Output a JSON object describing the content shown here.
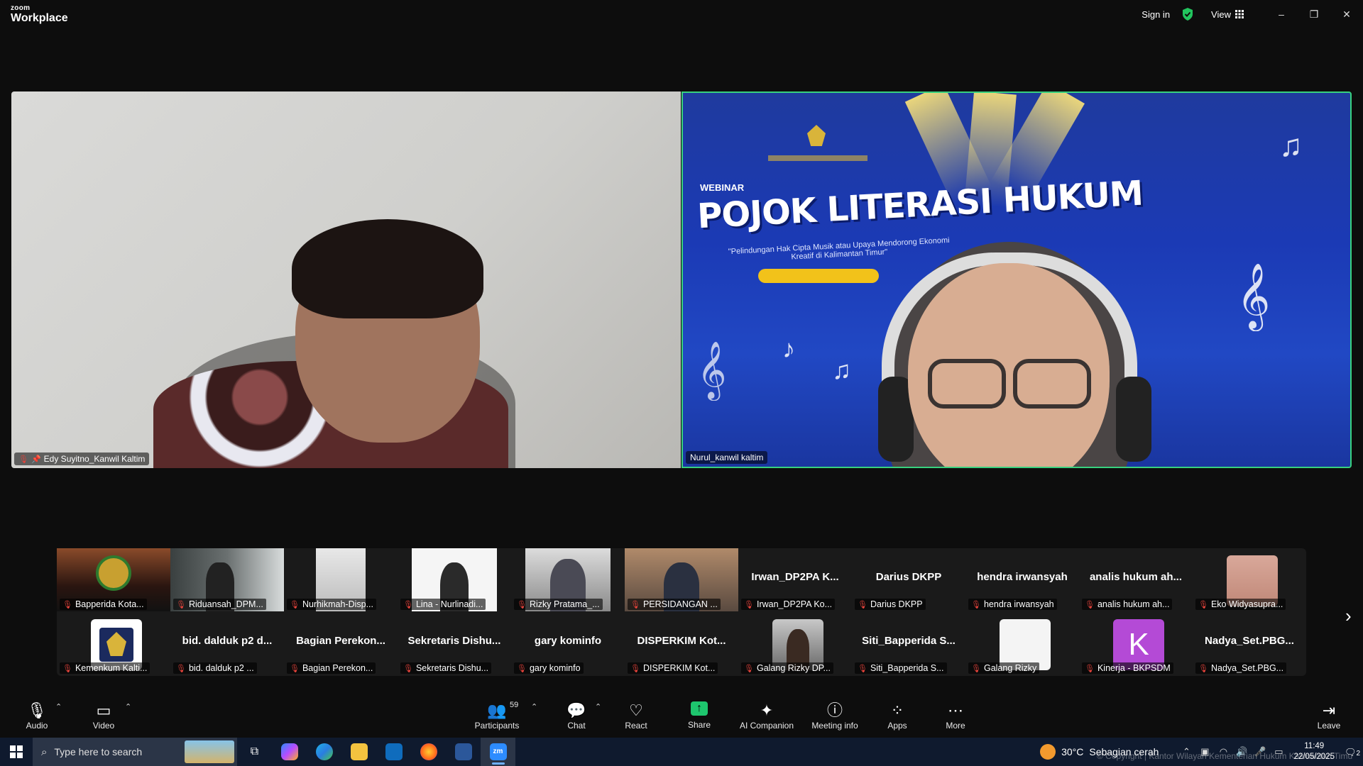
{
  "app": {
    "brand_small": "zoom",
    "brand_big": "Workplace"
  },
  "titlebar": {
    "sign_in": "Sign in",
    "view": "View",
    "minimize": "–",
    "restore": "❐",
    "close": "✕"
  },
  "main_videos": [
    {
      "name": "Edy Suyitno_Kanwil Kaltim"
    },
    {
      "name": "Nurul_kanwil kaltim"
    }
  ],
  "slide": {
    "label": "WEBINAR",
    "title": "POJOK LITERASI HUKUM",
    "subtitle": "\"Pelindungan Hak Cipta Musik atau Upaya Mendorong Ekonomi Kreatif di Kalimantan Timur\""
  },
  "gallery": {
    "row1": [
      {
        "tag": "Bapperida Kota...",
        "big": ""
      },
      {
        "tag": "Riduansah_DPM...",
        "big": ""
      },
      {
        "tag": "Nurhikmah-Disp...",
        "big": ""
      },
      {
        "tag": "Lina - Nurlinadi...",
        "big": ""
      },
      {
        "tag": "Rizky Pratama_...",
        "big": ""
      },
      {
        "tag": "PERSIDANGAN ...",
        "big": ""
      },
      {
        "tag": "Irwan_DP2PA Ko...",
        "big": "Irwan_DP2PA K..."
      },
      {
        "tag": "Darius DKPP",
        "big": "Darius DKPP"
      },
      {
        "tag": "hendra irwansyah",
        "big": "hendra irwansyah"
      },
      {
        "tag": "analis hukum ah...",
        "big": "analis hukum ah..."
      },
      {
        "tag": "Eko Widyasupra...",
        "big": ""
      }
    ],
    "row2": [
      {
        "tag": "Kemenkum Kalti...",
        "big": ""
      },
      {
        "tag": "bid. dalduk p2 ...",
        "big": "bid. dalduk p2 d..."
      },
      {
        "tag": "Bagian Perekon...",
        "big": "Bagian Perekon..."
      },
      {
        "tag": "Sekretaris Dishu...",
        "big": "Sekretaris Dishu..."
      },
      {
        "tag": "gary kominfo",
        "big": "gary kominfo"
      },
      {
        "tag": "DISPERKIM Kot...",
        "big": "DISPERKIM Kot..."
      },
      {
        "tag": "Galang Rizky DP...",
        "big": ""
      },
      {
        "tag": "Siti_Bapperida S...",
        "big": "Siti_Bapperida S..."
      },
      {
        "tag": "Galang Rizky",
        "big": ""
      },
      {
        "tag": "Kinerja - BKPSDM",
        "big": "",
        "avatar_letter": "K"
      },
      {
        "tag": "Nadya_Set.PBG...",
        "big": "Nadya_Set.PBG..."
      }
    ]
  },
  "toolbar": {
    "audio": "Audio",
    "video": "Video",
    "participants": "Participants",
    "participants_count": "59",
    "chat": "Chat",
    "react": "React",
    "share": "Share",
    "ai_companion": "AI Companion",
    "meeting_info": "Meeting info",
    "apps": "Apps",
    "more": "More",
    "leave": "Leave"
  },
  "taskbar": {
    "search_placeholder": "Type here to search",
    "weather_temp": "30°C",
    "weather_desc": "Sebagian cerah",
    "time": "11:49",
    "date": "22/05/2025",
    "notif_count": "2",
    "watermark": "© Copyright | Kantor Wilayah Kementerian Hukum Kalimantan Timur"
  },
  "colors": {
    "active_speaker_border": "#37d17e",
    "mute_red": "#e5433b",
    "share_green": "#1ec66e",
    "kinerja_purple": "#b44ad6"
  }
}
